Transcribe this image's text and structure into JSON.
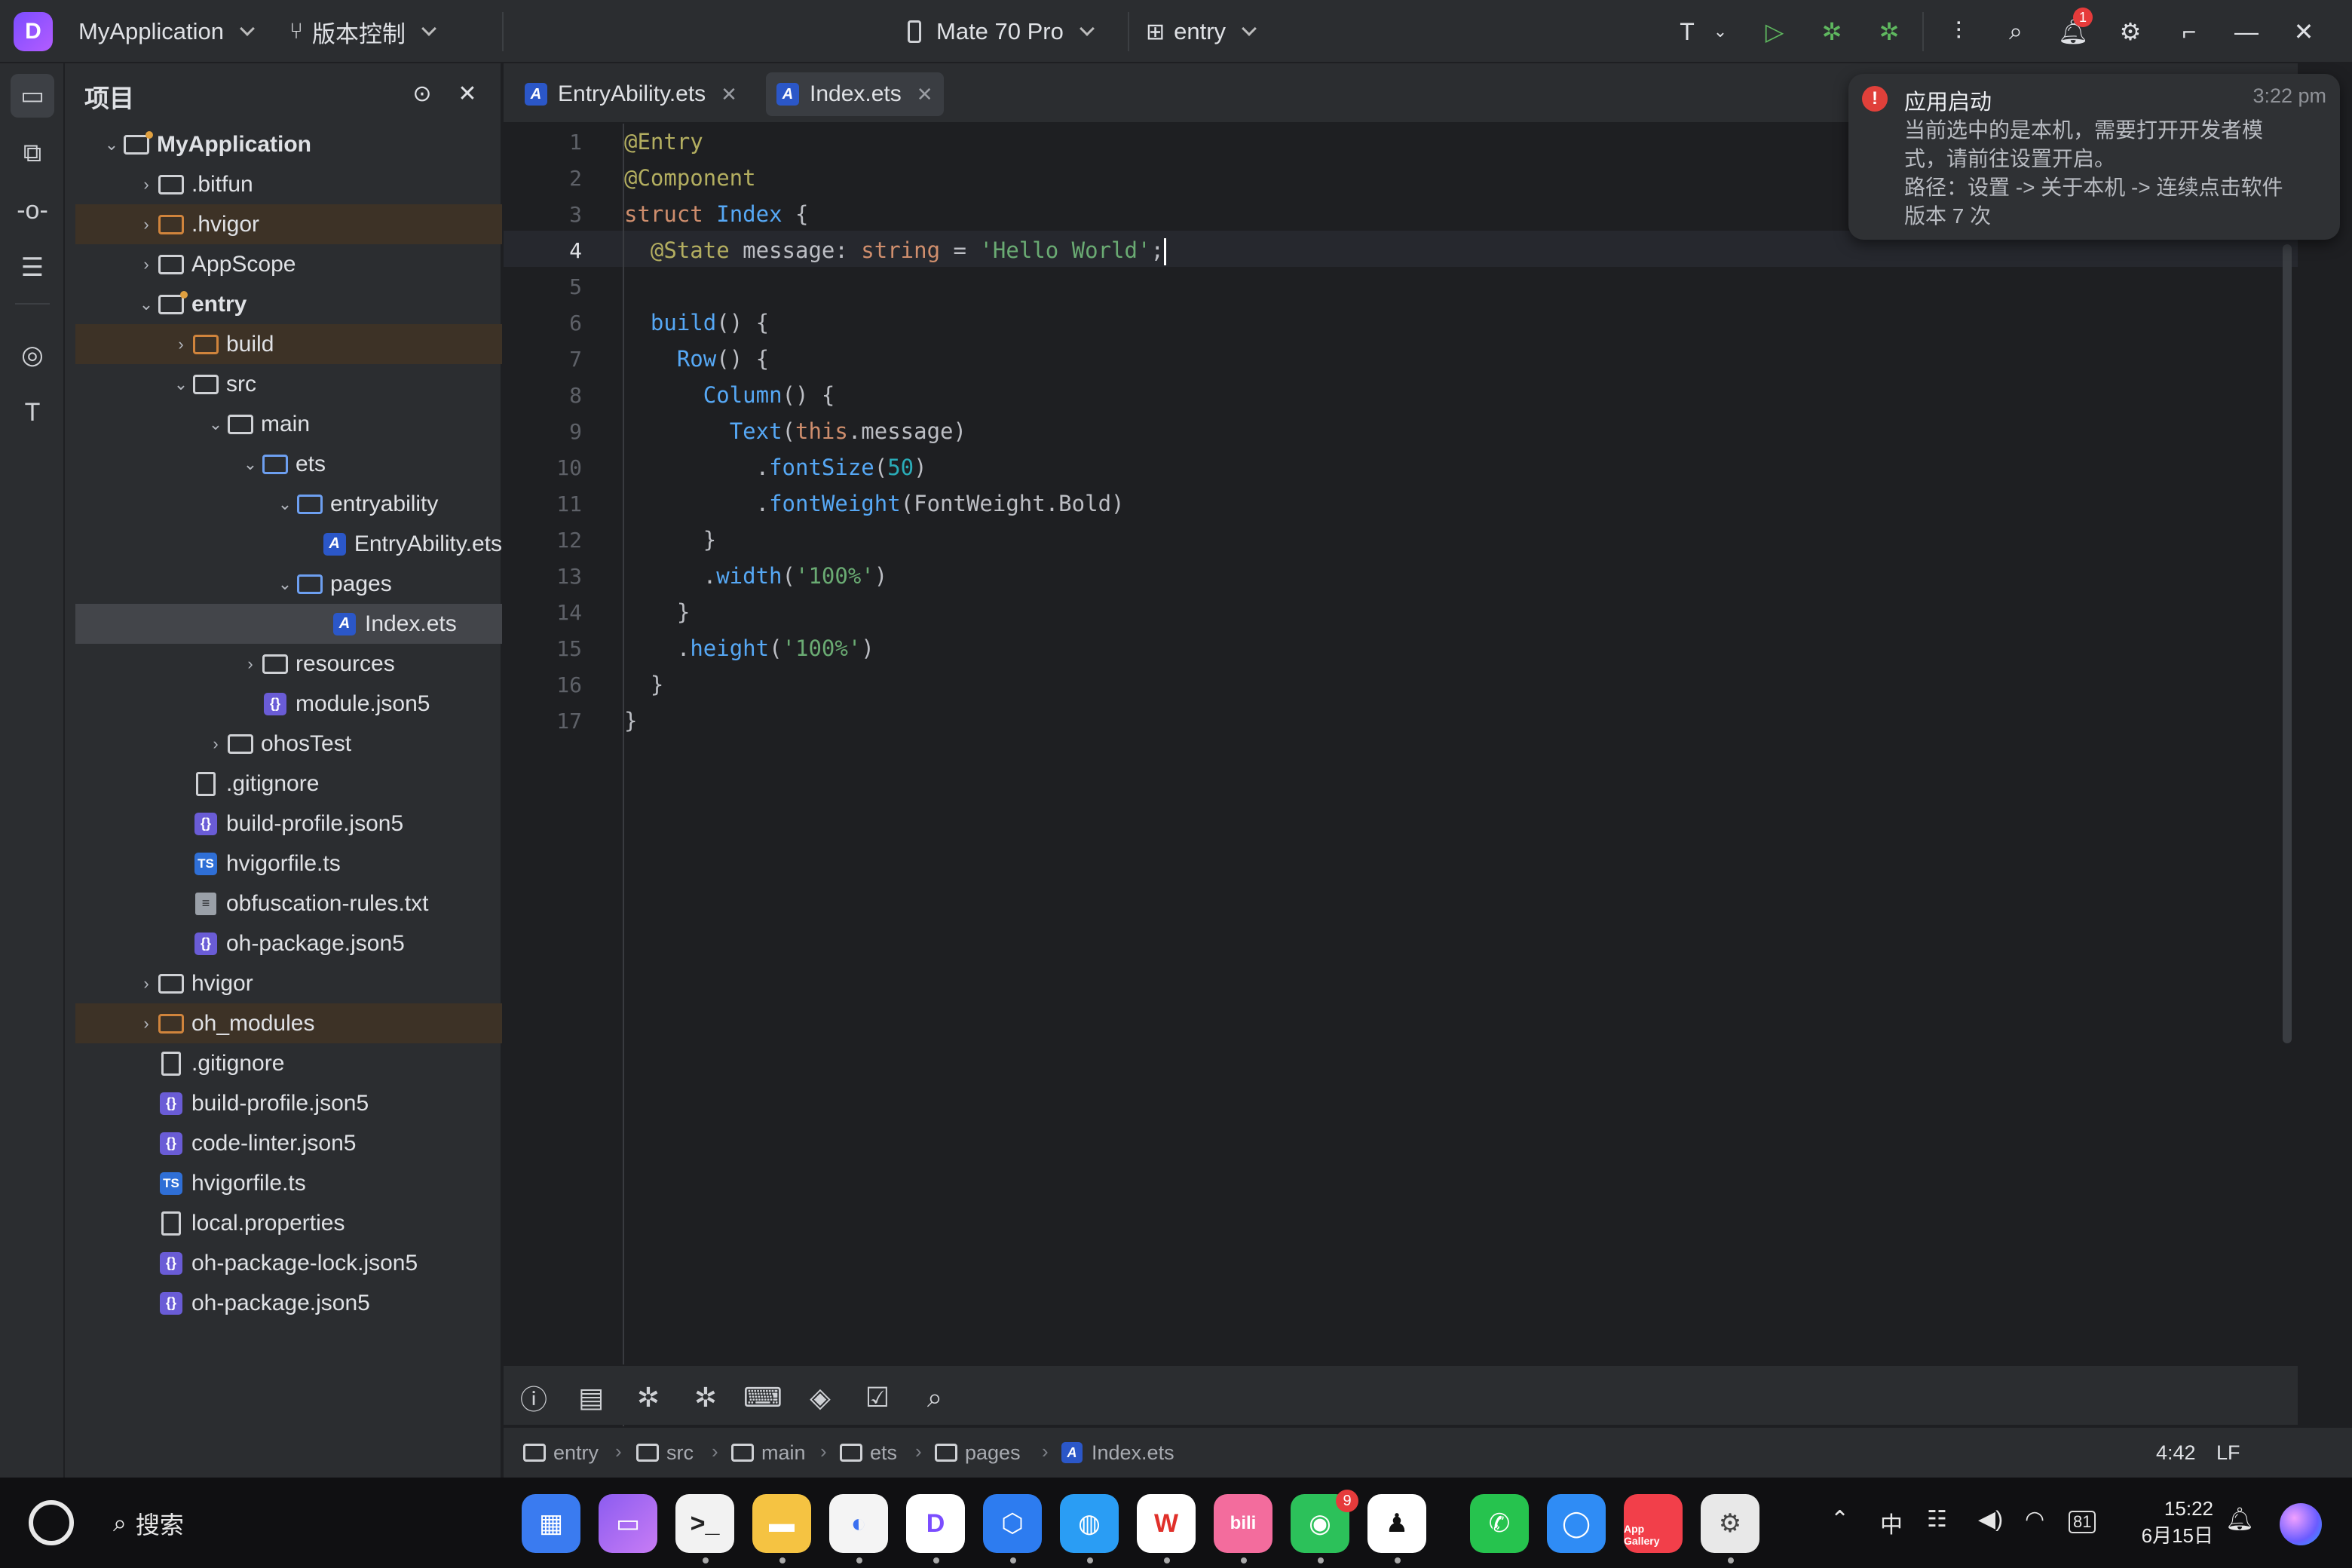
{
  "titlebar": {
    "app_name": "MyApplication",
    "vcs_label": "版本控制",
    "device": "Mate 70 Pro",
    "module": "entry",
    "notification_count": "1"
  },
  "project_panel": {
    "title": "项目",
    "tree": [
      {
        "label": "MyApplication",
        "bold": true
      },
      {
        "label": ".bitfun"
      },
      {
        "label": ".hvigor"
      },
      {
        "label": "AppScope"
      },
      {
        "label": "entry",
        "bold": true
      },
      {
        "label": "build"
      },
      {
        "label": "src"
      },
      {
        "label": "main"
      },
      {
        "label": "ets"
      },
      {
        "label": "entryability"
      },
      {
        "label": "EntryAbility.ets"
      },
      {
        "label": "pages"
      },
      {
        "label": "Index.ets"
      },
      {
        "label": "resources"
      },
      {
        "label": "module.json5"
      },
      {
        "label": "ohosTest"
      },
      {
        "label": ".gitignore"
      },
      {
        "label": "build-profile.json5"
      },
      {
        "label": "hvigorfile.ts"
      },
      {
        "label": "obfuscation-rules.txt"
      },
      {
        "label": "oh-package.json5"
      },
      {
        "label": "hvigor"
      },
      {
        "label": "oh_modules"
      },
      {
        "label": ".gitignore"
      },
      {
        "label": "build-profile.json5"
      },
      {
        "label": "code-linter.json5"
      },
      {
        "label": "hvigorfile.ts"
      },
      {
        "label": "local.properties"
      },
      {
        "label": "oh-package-lock.json5"
      },
      {
        "label": "oh-package.json5"
      }
    ]
  },
  "tabs": [
    {
      "label": "EntryAbility.ets"
    },
    {
      "label": "Index.ets"
    }
  ],
  "editor": {
    "line_numbers": [
      "1",
      "2",
      "3",
      "4",
      "5",
      "6",
      "7",
      "8",
      "9",
      "10",
      "11",
      "12",
      "13",
      "14",
      "15",
      "16",
      "17"
    ],
    "current_line": 4
  },
  "breadcrumb": [
    "entry",
    "src",
    "main",
    "ets",
    "pages",
    "Index.ets"
  ],
  "status": {
    "position": "4:42",
    "line_ending": "LF"
  },
  "notification": {
    "title": "应用启动",
    "time": "3:22 pm",
    "line1": "当前选中的是本机，需要打开开发者模",
    "line2": "式，请前往设置开启。",
    "line3": "路径：设置 -> 关于本机 -> 连续点击软件",
    "line4": "版本 7 次"
  },
  "taskbar": {
    "search_label": "搜索",
    "wechat_badge": "9",
    "appgallery_label": "App Gallery",
    "time": "15:22",
    "date": "6月15日",
    "battery": "81"
  }
}
